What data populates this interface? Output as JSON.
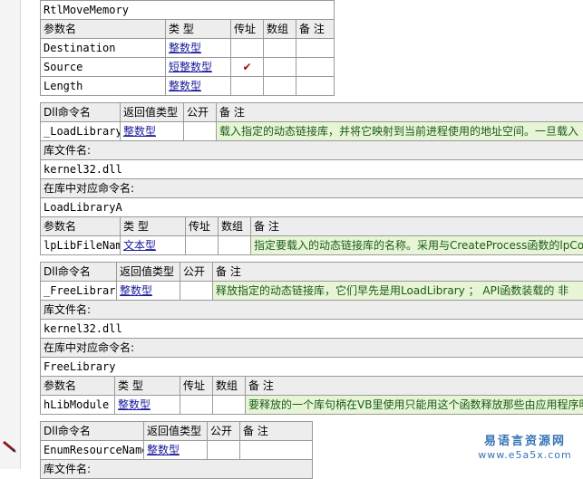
{
  "sections": [
    {
      "command_name": "RtlMoveMemory",
      "param_headers": [
        "参数名",
        "类 型",
        "传址",
        "数组",
        "备 注"
      ],
      "params": [
        {
          "name": "Destination",
          "type": "整数型",
          "byref": "",
          "array": "",
          "note": ""
        },
        {
          "name": "Source",
          "type": "短整数型",
          "byref": "✔",
          "array": "",
          "note": ""
        },
        {
          "name": "Length",
          "type": "整数型",
          "byref": "",
          "array": "",
          "note": ""
        }
      ]
    },
    {
      "cmd_headers": [
        "Dll命令名",
        "返回值类型",
        "公开",
        "备 注"
      ],
      "command_name": "_LoadLibrary",
      "return_type": "整数型",
      "public": "",
      "note": "载入指定的动态链接库，并将它映射到当前进程使用的地址空间。一旦载入",
      "lib_label": "库文件名:",
      "lib_file": "kernel32.dll",
      "entry_label": "在库中对应命令名:",
      "entry_name": "LoadLibraryA",
      "param_headers": [
        "参数名",
        "类 型",
        "传址",
        "数组",
        "备 注"
      ],
      "params": [
        {
          "name": "lpLibFileName",
          "type": "文本型",
          "byref": "",
          "array": "",
          "note": "指定要载入的动态链接库的名称。采用与CreateProcess函数的lpCom"
        }
      ]
    },
    {
      "cmd_headers": [
        "Dll命令名",
        "返回值类型",
        "公开",
        "备 注"
      ],
      "command_name": "_FreeLibrary",
      "return_type": "整数型",
      "public": "",
      "note": "释放指定的动态链接库，它们早先是用LoadLibrary ；   API函数装载的  非",
      "lib_label": "库文件名:",
      "lib_file": "kernel32.dll",
      "entry_label": "在库中对应命令名:",
      "entry_name": "FreeLibrary",
      "param_headers": [
        "参数名",
        "类 型",
        "传址",
        "数组",
        "备 注"
      ],
      "params": [
        {
          "name": "hLibModule",
          "type": "整数型",
          "byref": "",
          "array": "",
          "note": "要释放的一个库句柄在VB里使用只能用这个函数释放那些由应用程序明"
        }
      ]
    },
    {
      "cmd_headers": [
        "Dll命令名",
        "返回值类型",
        "公开",
        "备 注"
      ],
      "command_name": "EnumResourceNames",
      "return_type": "整数型",
      "public": "",
      "note": "",
      "lib_label": "库文件名:"
    }
  ],
  "watermark": {
    "line1": "易语言资源网",
    "line2": "www.e5a5x.com"
  },
  "colors": {
    "link": "#1a1a9a",
    "note_bg": "#e7f5d6",
    "header_bg": "#ededed",
    "watermark": "#3573b8"
  }
}
